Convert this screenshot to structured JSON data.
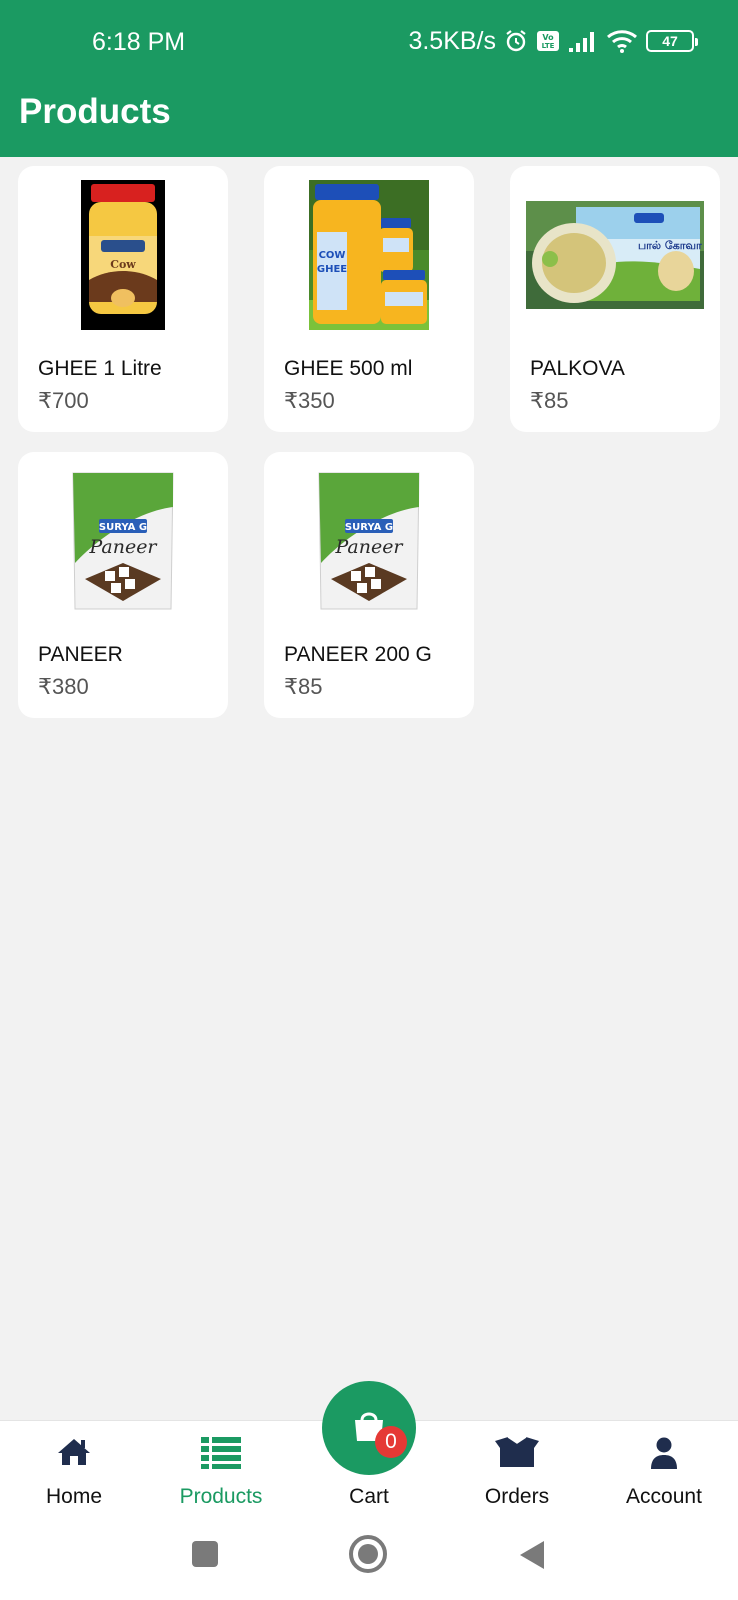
{
  "status_bar": {
    "time": "6:18 PM",
    "speed": "3.5KB/s",
    "battery": "47",
    "icons": [
      "alarm-icon",
      "volte-icon",
      "signal-icon",
      "wifi-icon",
      "battery-icon"
    ]
  },
  "header": {
    "title": "Products"
  },
  "products": [
    {
      "name": "GHEE 1 Litre",
      "price": "₹700"
    },
    {
      "name": "GHEE 500 ml",
      "price": "₹350"
    },
    {
      "name": "PALKOVA",
      "price": "₹85"
    },
    {
      "name": "PANEER",
      "price": "₹380"
    },
    {
      "name": "PANEER 200 G",
      "price": "₹85"
    }
  ],
  "bottom_nav": {
    "items": [
      {
        "label": "Home",
        "icon": "home-icon"
      },
      {
        "label": "Products",
        "icon": "list-icon",
        "active": true
      },
      {
        "label": "Cart",
        "icon": "shopping-bag-icon"
      },
      {
        "label": "Orders",
        "icon": "box-icon"
      },
      {
        "label": "Account",
        "icon": "user-icon"
      }
    ],
    "cart_count": "0"
  },
  "colors": {
    "primary": "#1b9a62",
    "background": "#f2f2f2",
    "badge": "#e53935",
    "nav_icon": "#1f2d4d"
  }
}
